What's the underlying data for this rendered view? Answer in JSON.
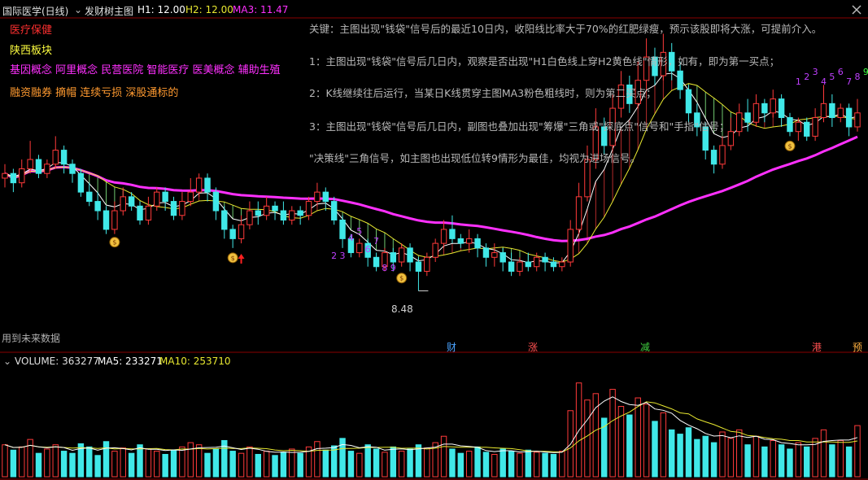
{
  "header": {
    "stock_name": "国际医学(日线)",
    "indicator_name": "发财树主图",
    "h1": "H1: 12.00",
    "h2": "H2: 12.00",
    "ma3": "MA3: 11.47"
  },
  "tags": [
    {
      "text": "医疗保健",
      "color": "#ff3030"
    },
    {
      "text": "陕西板块",
      "color": "#ffff40"
    },
    {
      "text": "基因概念 阿里概念 民营医院 智能医疗 医美概念 辅助生殖",
      "color": "#ff30ff"
    },
    {
      "text": "融资融券 摘帽 连续亏损 深股通标的",
      "color": "#ff9a30"
    }
  ],
  "notes": [
    "关键：主图出现\"钱袋\"信号后的最近10日内，收阳线比率大于70%的红肥绿瘦，预示该股即将大涨，可提前介入。",
    "1：主图出现\"钱袋\"信号后几日内，观察是否出现\"H1白色线上穿H2黄色线\"情形，如有，即为第一买点；",
    "2：K线继续往后运行，当某日K线贯穿主图MA3粉色粗线时，则为第二买点；",
    "3：主图出现\"钱袋\"信号后几日内，副图也叠加出现\"筹爆\"三角或\"探底点\"信号和\"手指\"信号；",
    "\"决策线\"三角信号，如主图也出现低位转9情形为最佳，均视为进场信号。"
  ],
  "future_data_label": "用到未来数据",
  "low_price_label": "8.48",
  "event_markers": [
    {
      "text": "财",
      "color": "#4aa3ff"
    },
    {
      "text": "涨",
      "color": "#ff5050"
    },
    {
      "text": "减",
      "color": "#40d040"
    },
    {
      "text": "港",
      "color": "#ff5050"
    },
    {
      "text": "预",
      "color": "#ffb040"
    }
  ],
  "volume_header": {
    "volume": "VOLUME: 363277",
    "ma5": "MA5: 233271",
    "ma10": "MA10: 253710"
  },
  "td_labels_left": [
    "2",
    "3",
    "4",
    "5",
    "6",
    "7",
    "8",
    "9"
  ],
  "td_labels_right": [
    "1",
    "2",
    "3",
    "4",
    "5",
    "6",
    "7",
    "8",
    "9"
  ],
  "colors": {
    "up": "#ff3a3a",
    "down": "#40e8e8",
    "h1_line": "#ffffff",
    "h2_line": "#e8e830",
    "ma3_line": "#ff30ff",
    "vol_ma5": "#ffffff",
    "vol_ma10": "#e8e830",
    "td_purple": "#c040ff",
    "td_green": "#40ff40",
    "signal_arrow": "#ff2020"
  },
  "chart_data": {
    "type": "candlestick",
    "y_min_label": 8.48,
    "price_range": [
      8.0,
      14.2
    ],
    "candles": [
      [
        10.9,
        11.0,
        10.7,
        11.2
      ],
      [
        11.0,
        10.8,
        10.6,
        11.1
      ],
      [
        10.8,
        11.1,
        10.7,
        11.3
      ],
      [
        11.1,
        11.3,
        11.0,
        11.7
      ],
      [
        11.3,
        11.0,
        10.9,
        11.4
      ],
      [
        11.0,
        11.2,
        10.9,
        11.3
      ],
      [
        11.2,
        11.5,
        11.1,
        11.8
      ],
      [
        11.5,
        11.2,
        11.0,
        11.6
      ],
      [
        11.2,
        11.0,
        10.8,
        11.3
      ],
      [
        11.0,
        10.6,
        10.5,
        11.1
      ],
      [
        10.6,
        10.4,
        10.3,
        10.8
      ],
      [
        10.4,
        10.2,
        10.0,
        10.6
      ],
      [
        10.2,
        9.8,
        9.7,
        10.3
      ],
      [
        9.8,
        10.2,
        9.7,
        10.4
      ],
      [
        10.2,
        10.5,
        10.1,
        10.7
      ],
      [
        10.5,
        10.3,
        10.2,
        10.6
      ],
      [
        10.3,
        10.0,
        9.9,
        10.4
      ],
      [
        10.0,
        10.3,
        9.9,
        10.5
      ],
      [
        10.3,
        10.6,
        10.2,
        10.7
      ],
      [
        10.6,
        10.4,
        10.2,
        10.7
      ],
      [
        10.4,
        10.1,
        10.0,
        10.5
      ],
      [
        10.1,
        10.4,
        10.0,
        10.6
      ],
      [
        10.4,
        10.6,
        10.3,
        10.9
      ],
      [
        10.6,
        10.9,
        10.5,
        11.0
      ],
      [
        10.9,
        10.6,
        10.4,
        11.0
      ],
      [
        10.6,
        10.2,
        10.0,
        10.7
      ],
      [
        10.2,
        9.8,
        9.6,
        10.3
      ],
      [
        9.8,
        9.6,
        9.4,
        9.9
      ],
      [
        9.6,
        9.9,
        9.5,
        10.1
      ],
      [
        9.9,
        10.2,
        9.8,
        10.4
      ],
      [
        10.2,
        10.1,
        9.9,
        10.4
      ],
      [
        10.1,
        10.3,
        10.0,
        10.5
      ],
      [
        10.3,
        10.2,
        10.0,
        10.4
      ],
      [
        10.2,
        10.0,
        9.9,
        10.4
      ],
      [
        10.0,
        10.2,
        9.9,
        10.3
      ],
      [
        10.2,
        10.1,
        9.9,
        10.3
      ],
      [
        10.1,
        10.4,
        10.0,
        10.5
      ],
      [
        10.4,
        10.6,
        10.3,
        10.8
      ],
      [
        10.6,
        10.4,
        10.2,
        10.7
      ],
      [
        10.4,
        10.0,
        9.9,
        10.5
      ],
      [
        10.0,
        9.6,
        9.4,
        10.1
      ],
      [
        9.6,
        9.3,
        9.2,
        9.7
      ],
      [
        9.3,
        9.5,
        9.2,
        9.6
      ],
      [
        9.5,
        9.2,
        9.0,
        9.6
      ],
      [
        9.2,
        9.0,
        8.9,
        9.3
      ],
      [
        9.0,
        9.3,
        8.9,
        9.4
      ],
      [
        9.3,
        9.1,
        8.9,
        9.4
      ],
      [
        9.1,
        9.4,
        9.0,
        9.5
      ],
      [
        9.4,
        9.1,
        8.9,
        9.5
      ],
      [
        9.1,
        8.9,
        8.48,
        9.2
      ],
      [
        8.9,
        9.2,
        8.8,
        9.3
      ],
      [
        9.2,
        9.5,
        9.1,
        9.6
      ],
      [
        9.5,
        9.8,
        9.4,
        10.0
      ],
      [
        9.8,
        9.6,
        9.5,
        10.1
      ],
      [
        9.6,
        9.5,
        9.4,
        9.7
      ],
      [
        9.5,
        9.6,
        9.3,
        9.8
      ],
      [
        9.6,
        9.4,
        9.2,
        9.7
      ],
      [
        9.4,
        9.2,
        9.0,
        9.5
      ],
      [
        9.2,
        9.3,
        9.0,
        9.5
      ],
      [
        9.3,
        9.1,
        8.9,
        9.4
      ],
      [
        9.1,
        8.9,
        8.8,
        9.3
      ],
      [
        8.9,
        9.1,
        8.8,
        9.2
      ],
      [
        9.1,
        9.0,
        8.9,
        9.3
      ],
      [
        9.0,
        9.2,
        8.9,
        9.3
      ],
      [
        9.2,
        9.1,
        8.9,
        9.3
      ],
      [
        9.1,
        9.0,
        8.9,
        9.2
      ],
      [
        9.0,
        9.1,
        8.9,
        9.2
      ],
      [
        9.1,
        9.8,
        9.0,
        10.0
      ],
      [
        9.8,
        10.5,
        9.7,
        10.8
      ],
      [
        10.5,
        11.3,
        10.4,
        11.6
      ],
      [
        11.3,
        12.0,
        11.1,
        12.4
      ],
      [
        12.0,
        11.6,
        11.4,
        12.2
      ],
      [
        11.6,
        12.4,
        11.5,
        12.7
      ],
      [
        12.4,
        12.9,
        12.2,
        13.2
      ],
      [
        12.9,
        12.5,
        12.3,
        13.1
      ],
      [
        12.5,
        13.0,
        12.4,
        13.4
      ],
      [
        13.0,
        13.5,
        12.8,
        13.9
      ],
      [
        13.5,
        13.1,
        12.9,
        13.7
      ],
      [
        13.1,
        13.6,
        13.0,
        14.0
      ],
      [
        13.6,
        13.2,
        13.0,
        13.8
      ],
      [
        13.2,
        12.8,
        12.6,
        13.4
      ],
      [
        12.8,
        12.3,
        12.1,
        12.9
      ],
      [
        12.3,
        12.0,
        11.8,
        12.5
      ],
      [
        12.0,
        11.5,
        11.3,
        12.1
      ],
      [
        11.5,
        11.2,
        11.0,
        11.6
      ],
      [
        11.2,
        11.6,
        11.1,
        11.8
      ],
      [
        11.6,
        11.9,
        11.5,
        12.2
      ],
      [
        11.9,
        12.3,
        11.8,
        12.5
      ],
      [
        12.3,
        12.1,
        11.9,
        12.6
      ],
      [
        12.1,
        12.5,
        12.0,
        12.7
      ],
      [
        12.5,
        12.3,
        12.1,
        12.6
      ],
      [
        12.3,
        12.6,
        12.2,
        12.8
      ],
      [
        12.6,
        12.2,
        12.0,
        12.7
      ],
      [
        12.2,
        11.9,
        11.8,
        12.3
      ],
      [
        11.9,
        12.1,
        11.7,
        12.2
      ],
      [
        12.1,
        11.8,
        11.7,
        12.2
      ],
      [
        11.8,
        12.2,
        11.7,
        12.4
      ],
      [
        12.2,
        12.5,
        12.1,
        12.9
      ],
      [
        12.5,
        12.2,
        12.0,
        12.7
      ],
      [
        12.2,
        12.4,
        12.1,
        12.5
      ],
      [
        12.4,
        12.0,
        11.8,
        12.5
      ],
      [
        12.0,
        12.3,
        11.9,
        12.6
      ]
    ],
    "volume": [
      0.3,
      0.25,
      0.28,
      0.35,
      0.22,
      0.26,
      0.3,
      0.24,
      0.22,
      0.31,
      0.28,
      0.2,
      0.33,
      0.24,
      0.27,
      0.22,
      0.3,
      0.26,
      0.24,
      0.21,
      0.25,
      0.28,
      0.32,
      0.3,
      0.22,
      0.26,
      0.34,
      0.24,
      0.22,
      0.28,
      0.21,
      0.24,
      0.2,
      0.23,
      0.26,
      0.22,
      0.28,
      0.33,
      0.25,
      0.29,
      0.36,
      0.24,
      0.22,
      0.3,
      0.26,
      0.23,
      0.28,
      0.24,
      0.26,
      0.3,
      0.27,
      0.32,
      0.38,
      0.26,
      0.22,
      0.24,
      0.28,
      0.23,
      0.21,
      0.26,
      0.24,
      0.22,
      0.25,
      0.23,
      0.22,
      0.21,
      0.24,
      0.62,
      0.88,
      0.72,
      0.78,
      0.55,
      0.82,
      0.66,
      0.58,
      0.74,
      0.68,
      0.52,
      0.6,
      0.44,
      0.4,
      0.46,
      0.35,
      0.38,
      0.32,
      0.42,
      0.36,
      0.44,
      0.3,
      0.38,
      0.28,
      0.34,
      0.3,
      0.26,
      0.32,
      0.28,
      0.36,
      0.44,
      0.3,
      0.34,
      0.28,
      0.48
    ]
  }
}
